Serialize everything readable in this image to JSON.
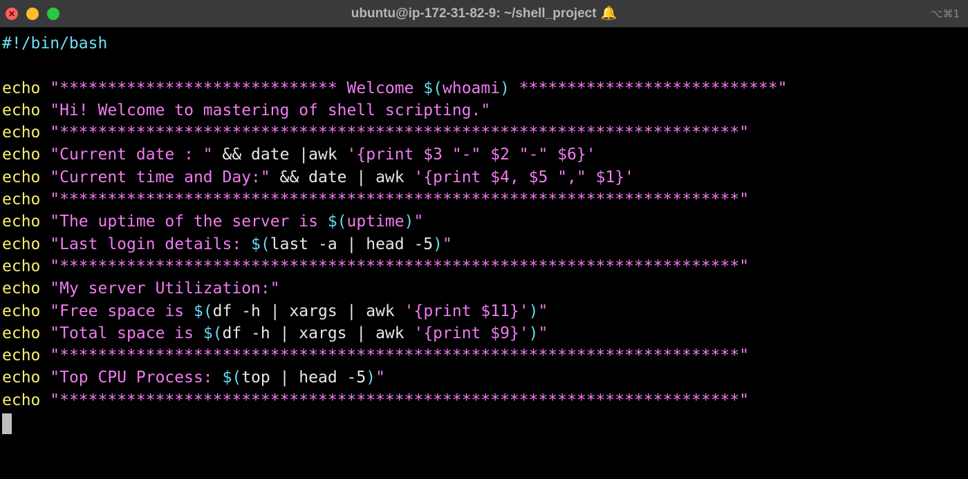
{
  "window": {
    "title": "ubuntu@ip-172-31-82-9: ~/shell_project",
    "bell_icon": "bell-icon",
    "shortcut": "⌥⌘1"
  },
  "terminal": {
    "lines": [
      [
        {
          "t": "#!/bin/bash",
          "c": "sh"
        }
      ],
      [],
      [
        {
          "t": "echo",
          "c": "kw"
        },
        {
          "t": " ",
          "c": "plain"
        },
        {
          "t": "\"***************************** Welcome ",
          "c": "str"
        },
        {
          "t": "$(",
          "c": "sub"
        },
        {
          "t": "whoami",
          "c": "str"
        },
        {
          "t": ")",
          "c": "sub"
        },
        {
          "t": " ***************************\"",
          "c": "str"
        }
      ],
      [
        {
          "t": "echo",
          "c": "kw"
        },
        {
          "t": " ",
          "c": "plain"
        },
        {
          "t": "\"Hi! Welcome to mastering of shell scripting.\"",
          "c": "str"
        }
      ],
      [
        {
          "t": "echo",
          "c": "kw"
        },
        {
          "t": " ",
          "c": "plain"
        },
        {
          "t": "\"***********************************************************************\"",
          "c": "str"
        }
      ],
      [
        {
          "t": "echo",
          "c": "kw"
        },
        {
          "t": " ",
          "c": "plain"
        },
        {
          "t": "\"Current date : \"",
          "c": "str"
        },
        {
          "t": " && date |awk ",
          "c": "plain"
        },
        {
          "t": "'{print $3 \"-\" $2 \"-\" $6}'",
          "c": "str"
        }
      ],
      [
        {
          "t": "echo",
          "c": "kw"
        },
        {
          "t": " ",
          "c": "plain"
        },
        {
          "t": "\"Current time and Day:\"",
          "c": "str"
        },
        {
          "t": " && date | awk ",
          "c": "plain"
        },
        {
          "t": "'{print $4, $5 \",\" $1}'",
          "c": "str"
        }
      ],
      [
        {
          "t": "echo",
          "c": "kw"
        },
        {
          "t": " ",
          "c": "plain"
        },
        {
          "t": "\"***********************************************************************\"",
          "c": "str"
        }
      ],
      [
        {
          "t": "echo",
          "c": "kw"
        },
        {
          "t": " ",
          "c": "plain"
        },
        {
          "t": "\"The uptime of the server is ",
          "c": "str"
        },
        {
          "t": "$(",
          "c": "sub"
        },
        {
          "t": "uptime",
          "c": "str"
        },
        {
          "t": ")",
          "c": "sub"
        },
        {
          "t": "\"",
          "c": "str"
        }
      ],
      [
        {
          "t": "echo",
          "c": "kw"
        },
        {
          "t": " ",
          "c": "plain"
        },
        {
          "t": "\"Last login details: ",
          "c": "str"
        },
        {
          "t": "$(",
          "c": "sub"
        },
        {
          "t": "last -a | head -5",
          "c": "plain"
        },
        {
          "t": ")",
          "c": "sub"
        },
        {
          "t": "\"",
          "c": "str"
        }
      ],
      [
        {
          "t": "echo",
          "c": "kw"
        },
        {
          "t": " ",
          "c": "plain"
        },
        {
          "t": "\"***********************************************************************\"",
          "c": "str"
        }
      ],
      [
        {
          "t": "echo",
          "c": "kw"
        },
        {
          "t": " ",
          "c": "plain"
        },
        {
          "t": "\"My server Utilization:\"",
          "c": "str"
        }
      ],
      [
        {
          "t": "echo",
          "c": "kw"
        },
        {
          "t": " ",
          "c": "plain"
        },
        {
          "t": "\"Free space is ",
          "c": "str"
        },
        {
          "t": "$(",
          "c": "sub"
        },
        {
          "t": "df -h | xargs | awk ",
          "c": "plain"
        },
        {
          "t": "'{print $11}'",
          "c": "str"
        },
        {
          "t": ")",
          "c": "sub"
        },
        {
          "t": "\"",
          "c": "str"
        }
      ],
      [
        {
          "t": "echo",
          "c": "kw"
        },
        {
          "t": " ",
          "c": "plain"
        },
        {
          "t": "\"Total space is ",
          "c": "str"
        },
        {
          "t": "$(",
          "c": "sub"
        },
        {
          "t": "df -h | xargs | awk ",
          "c": "plain"
        },
        {
          "t": "'{print $9}'",
          "c": "str"
        },
        {
          "t": ")",
          "c": "sub"
        },
        {
          "t": "\"",
          "c": "str"
        }
      ],
      [
        {
          "t": "echo",
          "c": "kw"
        },
        {
          "t": " ",
          "c": "plain"
        },
        {
          "t": "\"***********************************************************************\"",
          "c": "str"
        }
      ],
      [
        {
          "t": "echo",
          "c": "kw"
        },
        {
          "t": " ",
          "c": "plain"
        },
        {
          "t": "\"Top CPU Process: ",
          "c": "str"
        },
        {
          "t": "$(",
          "c": "sub"
        },
        {
          "t": "top | head -5",
          "c": "plain"
        },
        {
          "t": ")",
          "c": "sub"
        },
        {
          "t": "\"",
          "c": "str"
        }
      ],
      [
        {
          "t": "echo",
          "c": "kw"
        },
        {
          "t": " ",
          "c": "plain"
        },
        {
          "t": "\"***********************************************************************\"",
          "c": "str"
        }
      ]
    ]
  }
}
